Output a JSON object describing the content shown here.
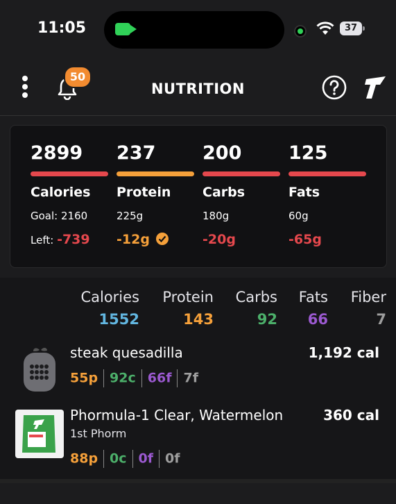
{
  "status_bar": {
    "time": "11:05",
    "battery": "37"
  },
  "header": {
    "title": "NUTRITION",
    "notification_count": "50"
  },
  "summary": [
    {
      "value": "2899",
      "name": "Calories",
      "goal": "Goal: 2160",
      "left_label": "Left:",
      "left": "-739",
      "color": "#e5484d"
    },
    {
      "value": "237",
      "name": "Protein",
      "goal": "225g",
      "left_label": "",
      "left": "-12g",
      "color": "#f5a03a"
    },
    {
      "value": "200",
      "name": "Carbs",
      "goal": "180g",
      "left_label": "",
      "left": "-20g",
      "color": "#e5484d"
    },
    {
      "value": "125",
      "name": "Fats",
      "goal": "60g",
      "left_label": "",
      "left": "-65g",
      "color": "#e5484d"
    }
  ],
  "totals": {
    "headers": [
      "Calories",
      "Protein",
      "Carbs",
      "Fats",
      "Fiber"
    ],
    "values": [
      "1552",
      "143",
      "92",
      "66",
      "7"
    ],
    "colors": [
      "#62b6e0",
      "#f5a03a",
      "#4caf6a",
      "#9b59d0",
      "#9e9e9e"
    ]
  },
  "entries": [
    {
      "name": "steak quesadilla",
      "brand": "",
      "calories": "1,192 cal",
      "protein": "55p",
      "carbs": "92c",
      "fat": "66f",
      "fiber": "7f"
    },
    {
      "name": "Phormula-1 Clear, Watermelon",
      "brand": "1st Phorm",
      "calories": "360 cal",
      "protein": "88p",
      "carbs": "0c",
      "fat": "0f",
      "fiber": "0f"
    }
  ]
}
